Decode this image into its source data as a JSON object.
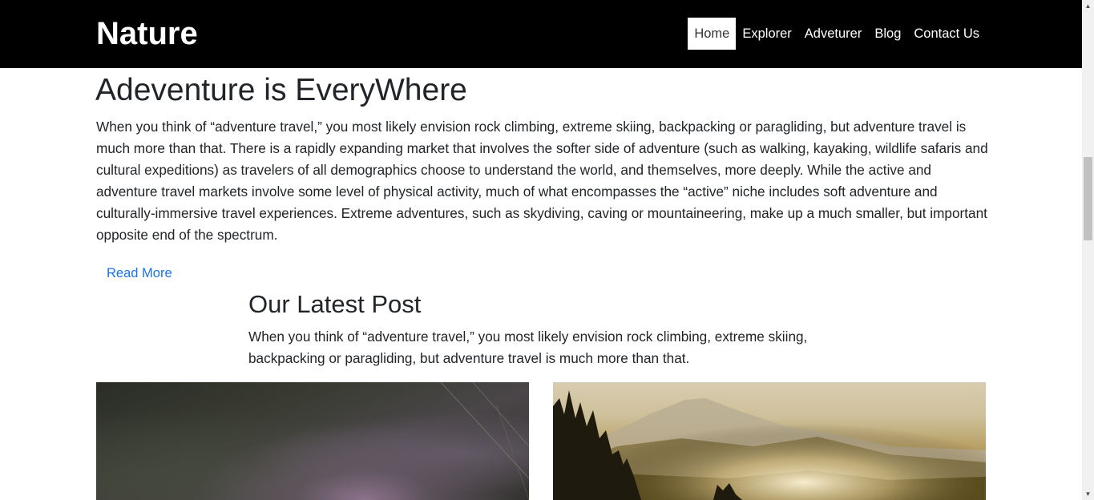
{
  "header": {
    "brand": "Nature",
    "nav": [
      {
        "label": "Home",
        "active": true
      },
      {
        "label": "Explorer",
        "active": false
      },
      {
        "label": "Adveturer",
        "active": false
      },
      {
        "label": "Blog",
        "active": false
      },
      {
        "label": "Contact Us",
        "active": false
      }
    ]
  },
  "hero": {
    "title": "Adeventure is EveryWhere",
    "text": "When you think of “adventure travel,” you most likely envision rock climbing, extreme skiing, backpacking or paragliding, but adventure travel is much more than that. There is a rapidly expanding market that involves the softer side of adventure (such as walking, kayaking, wildlife safaris and cultural expeditions) as travelers of all demographics choose to understand the world, and themselves, more deeply. While the active and adventure travel markets involve some level of physical activity, much of what encompasses the “active” niche includes soft adventure and culturally-immersive travel experiences. Extreme adventures, such as skydiving, caving or mountaineering, make up a much smaller, but important opposite end of the spectrum.",
    "read_more": "Read More"
  },
  "latest": {
    "title": "Our Latest Post",
    "text": "When you think of “adventure travel,” you most likely envision rock climbing, extreme skiing, backpacking or paragliding, but adventure travel is much more than that."
  },
  "colors": {
    "header_bg": "#000000",
    "link": "#1a73e8",
    "text": "#212529"
  },
  "icons": {
    "scroll_up": "▲",
    "scroll_down": "▼"
  }
}
